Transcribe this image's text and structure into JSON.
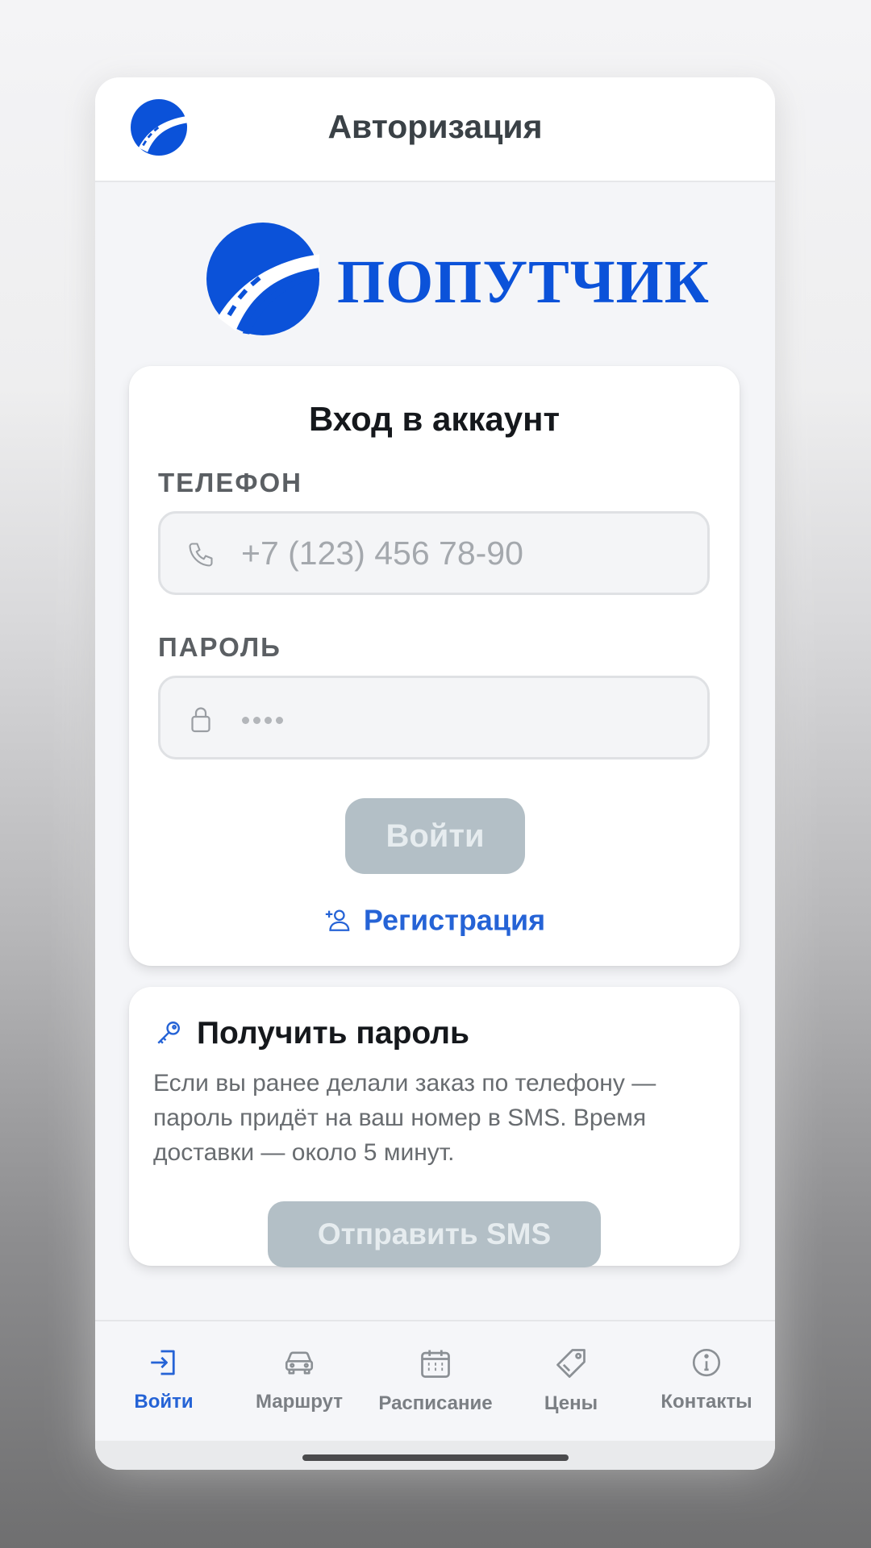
{
  "header": {
    "title": "Авторизация",
    "logo_icon": "road-logo-icon"
  },
  "brand": {
    "name": "ПОПУТЧИК",
    "color": "#0b52d9"
  },
  "login": {
    "title": "Вход в аккаунт",
    "phone_label": "ТЕЛЕФОН",
    "phone_placeholder": "+7 (123) 456 78-90",
    "phone_icon": "phone-icon",
    "password_label": "ПАРОЛЬ",
    "password_icon": "lock-icon",
    "password_masked_length": 4,
    "submit_label": "Войти",
    "register_label": "Регистрация",
    "register_icon": "user-plus-icon"
  },
  "get_password": {
    "title": "Получить пароль",
    "icon": "key-icon",
    "description": "Если вы ранее делали заказ по телефону — пароль придёт на ваш номер в SMS. Время доставки — около 5 минут.",
    "button_label": "Отправить SMS"
  },
  "nav": {
    "items": [
      {
        "label": "Войти",
        "icon": "login-icon",
        "active": true
      },
      {
        "label": "Маршрут",
        "icon": "car-icon",
        "active": false
      },
      {
        "label": "Расписание",
        "icon": "calendar-icon",
        "active": false
      },
      {
        "label": "Цены",
        "icon": "tag-icon",
        "active": false
      },
      {
        "label": "Контакты",
        "icon": "info-icon",
        "active": false
      }
    ]
  },
  "colors": {
    "accent": "#2563d6",
    "disabled_button": "#b3bfc6",
    "background": "#f4f5f8"
  }
}
